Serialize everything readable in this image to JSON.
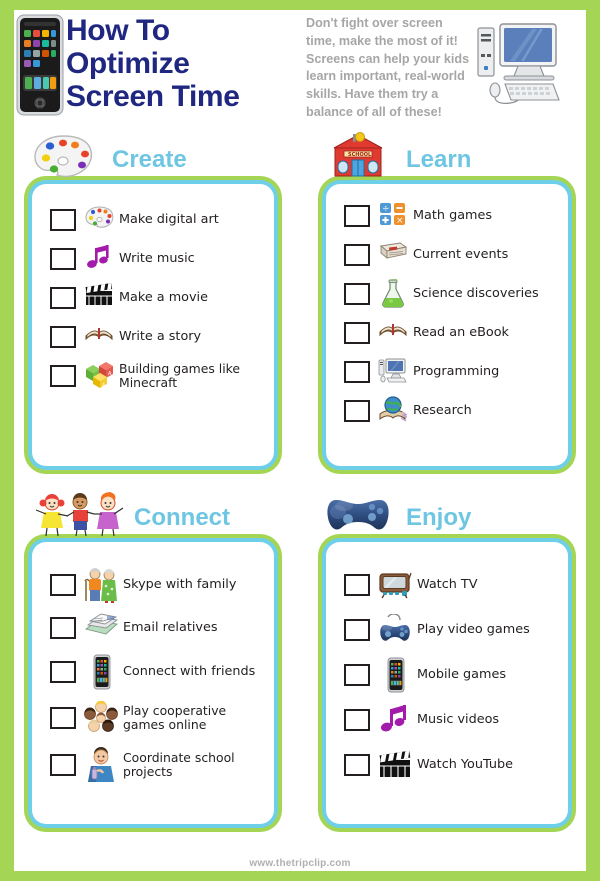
{
  "header": {
    "title_lines": [
      "How To",
      "Optimize",
      "Screen Time"
    ],
    "blurb": "Don't fight over screen time, make the most of it! Screens can help your kids learn important, real-world skills. Have them try a balance of all of these!",
    "phone_icon": "smartphone-icon",
    "computer_icon": "desktop-computer-icon",
    "title_color": "#1F2781",
    "blurb_color": "#A6A6A6"
  },
  "theme": {
    "page_border": "#A4D555",
    "card_outer": "#A4D555",
    "card_inner": "#6ECFE8",
    "heading": "#6EC6E2",
    "text": "#231F20"
  },
  "sections": [
    {
      "title": "Create",
      "emblem": "paint-palette-icon",
      "items": [
        {
          "icon": "paint-palette-icon",
          "label": "Make digital art",
          "checked": false
        },
        {
          "icon": "music-note-icon",
          "label": "Write music",
          "checked": false
        },
        {
          "icon": "clapperboard-icon",
          "label": "Make a movie",
          "checked": false
        },
        {
          "icon": "open-book-icon",
          "label": "Write a story",
          "checked": false
        },
        {
          "icon": "building-blocks-icon",
          "label": "Building games like Minecraft",
          "checked": false
        }
      ]
    },
    {
      "title": "Learn",
      "emblem": "schoolhouse-icon",
      "items": [
        {
          "icon": "math-symbols-icon",
          "label": "Math games",
          "checked": false
        },
        {
          "icon": "newspaper-icon",
          "label": "Current events",
          "checked": false
        },
        {
          "icon": "flask-icon",
          "label": "Science discoveries",
          "checked": false
        },
        {
          "icon": "open-book-icon",
          "label": "Read an eBook",
          "checked": false
        },
        {
          "icon": "desktop-computer-icon",
          "label": "Programming",
          "checked": false
        },
        {
          "icon": "globe-book-icon",
          "label": "Research",
          "checked": false
        }
      ]
    },
    {
      "title": "Connect",
      "emblem": "children-holding-hands-icon",
      "items": [
        {
          "icon": "grandparents-icon",
          "label": "Skype with family",
          "checked": false
        },
        {
          "icon": "envelope-icon",
          "label": "Email relatives",
          "checked": false
        },
        {
          "icon": "smartphone-icon",
          "label": "Connect with friends",
          "checked": false
        },
        {
          "icon": "group-of-people-icon",
          "label": "Play cooperative games online",
          "checked": false
        },
        {
          "icon": "person-phone-icon",
          "label": "Coordinate school projects",
          "checked": false
        }
      ]
    },
    {
      "title": "Enjoy",
      "emblem": "game-controller-icon",
      "items": [
        {
          "icon": "television-icon",
          "label": "Watch TV",
          "checked": false
        },
        {
          "icon": "game-controller-icon",
          "label": "Play video games",
          "checked": false
        },
        {
          "icon": "smartphone-icon",
          "label": "Mobile games",
          "checked": false
        },
        {
          "icon": "music-note-icon",
          "label": "Music videos",
          "checked": false
        },
        {
          "icon": "clapperboard-icon",
          "label": "Watch YouTube",
          "checked": false
        }
      ]
    }
  ],
  "footer": {
    "url": "www.thetripclip.com"
  }
}
